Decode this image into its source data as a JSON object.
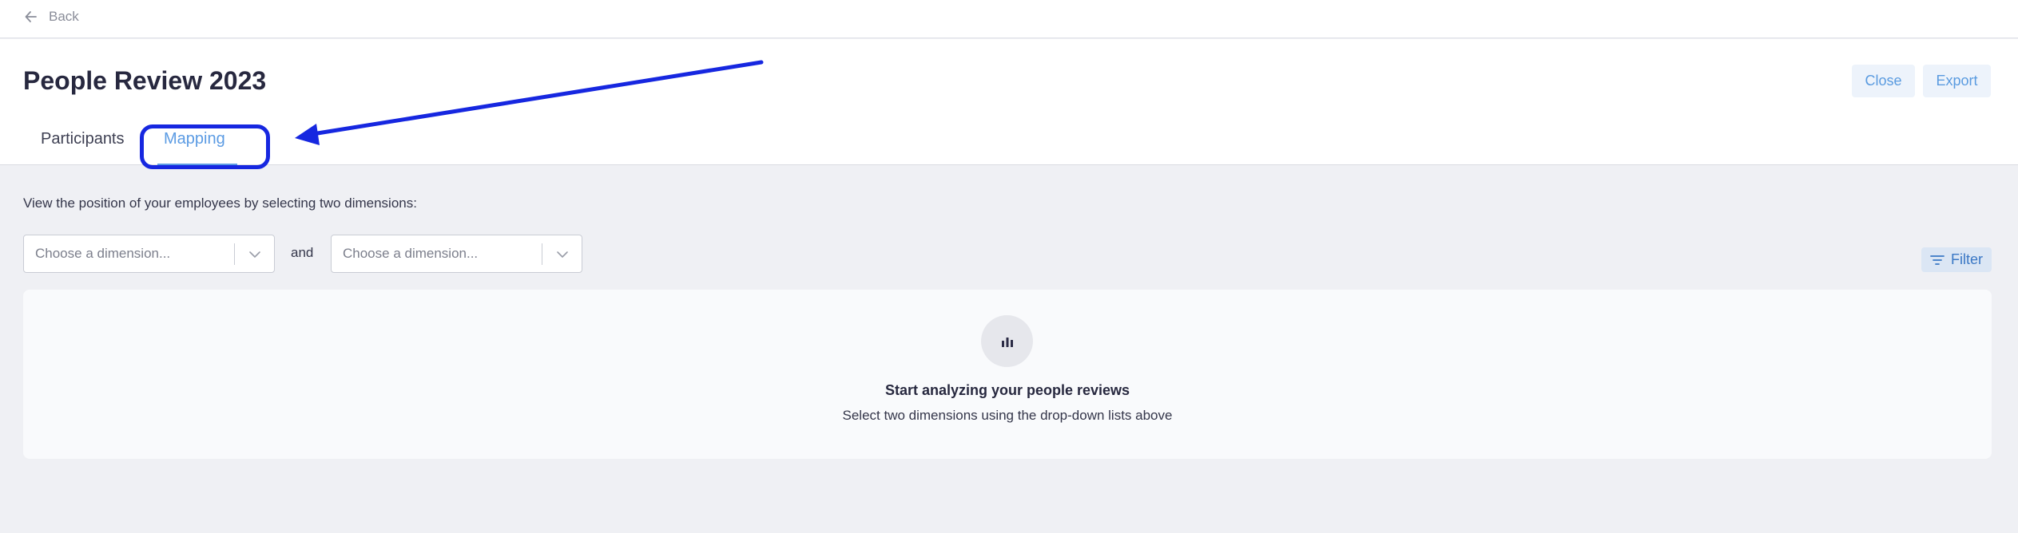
{
  "topbar": {
    "back_label": "Back"
  },
  "header": {
    "title": "People Review 2023",
    "close_label": "Close",
    "export_label": "Export"
  },
  "tabs": [
    {
      "label": "Participants",
      "active": false
    },
    {
      "label": "Mapping",
      "active": true
    }
  ],
  "mapping": {
    "instruction": "View the position of your employees by selecting two dimensions:",
    "dimension_1": {
      "placeholder": "Choose a dimension..."
    },
    "connector": "and",
    "dimension_2": {
      "placeholder": "Choose a dimension..."
    },
    "filter_label": "Filter"
  },
  "empty_state": {
    "icon": "bar-chart-icon",
    "title": "Start analyzing your people reviews",
    "subtitle": "Select two dimensions using the drop-down lists above"
  },
  "annotation": {
    "color": "#1627e0",
    "target": "Mapping tab"
  },
  "colors": {
    "accent": "#5b9be3",
    "page_bg": "#eff0f4"
  }
}
